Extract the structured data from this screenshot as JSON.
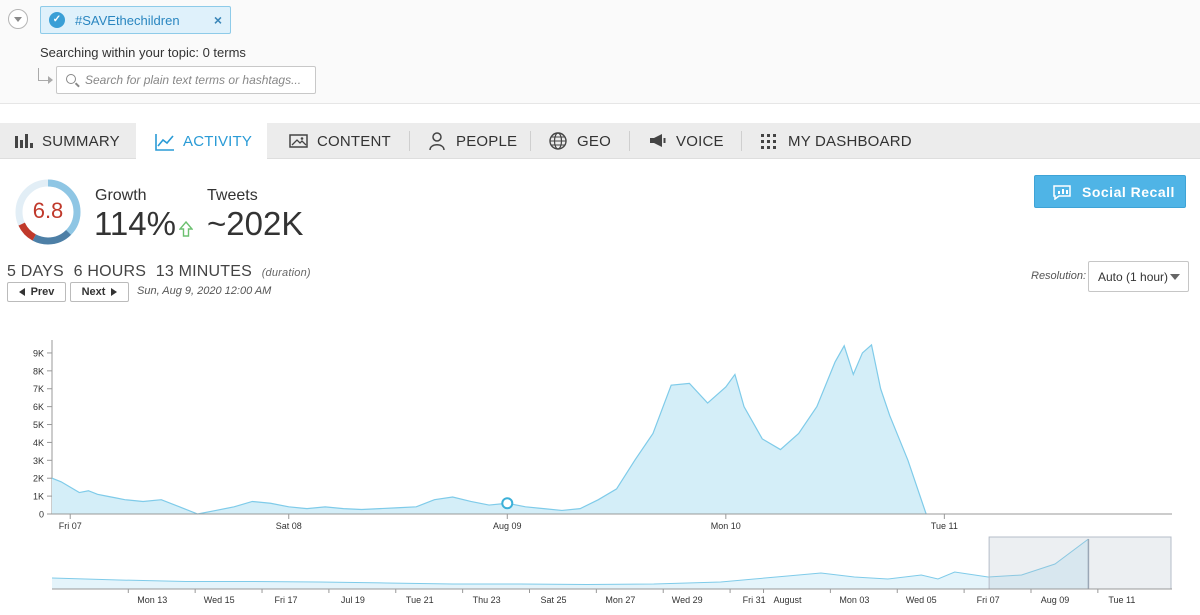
{
  "topic": {
    "tag": "#SAVEthechildren",
    "search_hint": "Searching within your topic: 0 terms",
    "search_placeholder": "Search for plain text terms or hashtags..."
  },
  "tabs": [
    {
      "label": "SUMMARY",
      "icon": "bar-chart-icon",
      "active": false
    },
    {
      "label": "ACTIVITY",
      "icon": "line-chart-icon",
      "active": true
    },
    {
      "label": "CONTENT",
      "icon": "image-icon",
      "active": false
    },
    {
      "label": "PEOPLE",
      "icon": "person-icon",
      "active": false
    },
    {
      "label": "GEO",
      "icon": "globe-icon",
      "active": false
    },
    {
      "label": "VOICE",
      "icon": "megaphone-icon",
      "active": false
    },
    {
      "label": "MY DASHBOARD",
      "icon": "grid-icon",
      "active": false
    }
  ],
  "stats": {
    "score": "6.8",
    "score_fraction": 0.68,
    "growth_label": "Growth",
    "growth_value": "114%",
    "tweets_label": "Tweets",
    "tweets_value": "~202K"
  },
  "social_recall_label": "Social Recall",
  "duration": {
    "days": "5 DAYS",
    "hours": "6 HOURS",
    "minutes": "13 MINUTES",
    "suffix": "(duration)"
  },
  "nav": {
    "prev_label": "Prev",
    "next_label": "Next",
    "current_date": "Sun, Aug 9, 2020 12:00 AM"
  },
  "resolution": {
    "label": "Resolution:",
    "value": "Auto (1 hour)"
  },
  "colors": {
    "accent": "#2a9bd6",
    "area_fill": "#d4eef8",
    "area_stroke": "#7fcbe9",
    "score_red": "#c0392b",
    "button_blue": "#4fb4e6"
  },
  "chart_data": [
    {
      "type": "area",
      "ylim": [
        0,
        9500
      ],
      "yticks": [
        0,
        1000,
        2000,
        3000,
        4000,
        5000,
        6000,
        7000,
        8000,
        9000
      ],
      "ytick_labels": [
        "0",
        "1K",
        "2K",
        "3K",
        "4K",
        "5K",
        "6K",
        "7K",
        "8K",
        "9K"
      ],
      "xlim": [
        -2,
        121
      ],
      "xticks": [
        0,
        24,
        48,
        72,
        96
      ],
      "xtick_labels": [
        "Fri 07",
        "Sat 08",
        "Aug 09",
        "Mon 10",
        "Tue 11"
      ],
      "x": [
        -2,
        -1,
        0,
        1,
        2,
        3,
        4,
        5,
        6,
        8,
        10,
        12,
        14,
        16,
        18,
        20,
        22,
        24,
        26,
        28,
        30,
        32,
        34,
        36,
        38,
        40,
        42,
        44,
        46,
        48,
        50,
        52,
        54,
        56,
        58,
        60,
        62,
        64,
        66,
        68,
        70,
        72,
        73,
        74,
        76,
        78,
        80,
        82,
        84,
        85,
        86,
        87,
        88,
        89,
        90,
        92,
        94
      ],
      "y": [
        2000,
        1800,
        1500,
        1200,
        1300,
        1100,
        1000,
        900,
        800,
        700,
        800,
        400,
        0,
        200,
        400,
        700,
        600,
        400,
        300,
        400,
        300,
        250,
        300,
        350,
        400,
        800,
        950,
        700,
        500,
        600,
        400,
        300,
        200,
        300,
        800,
        1400,
        3000,
        4500,
        7200,
        7300,
        6200,
        7100,
        7800,
        6000,
        4200,
        3600,
        4500,
        6000,
        8500,
        9400,
        7800,
        9000,
        9450,
        7000,
        5500,
        3000,
        0
      ],
      "marker": {
        "x": 48,
        "y": 600
      }
    },
    {
      "type": "area",
      "role": "navigator",
      "xtick_labels": [
        "Mon 13",
        "Wed 15",
        "Fri 17",
        "Jul 19",
        "Tue 21",
        "Thu 23",
        "Sat 25",
        "Mon 27",
        "Wed 29",
        "Fri 31",
        "August",
        "Mon 03",
        "Wed 05",
        "Fri 07",
        "Aug 09",
        "Tue 11"
      ],
      "xticks": [
        8,
        12,
        16,
        20,
        24,
        28,
        32,
        36,
        40,
        44,
        46,
        50,
        54,
        58,
        62,
        66
      ],
      "xlim": [
        2,
        69
      ],
      "ylim": [
        0,
        100
      ],
      "x": [
        2,
        6,
        10,
        14,
        18,
        22,
        26,
        30,
        34,
        38,
        42,
        44,
        46,
        48,
        50,
        52,
        54,
        55,
        56,
        58,
        60,
        62,
        64
      ],
      "y": [
        22,
        18,
        15,
        15,
        14,
        12,
        10,
        10,
        9,
        10,
        14,
        20,
        26,
        32,
        24,
        20,
        28,
        20,
        34,
        24,
        28,
        50,
        100
      ],
      "selection": [
        58,
        64
      ]
    }
  ]
}
